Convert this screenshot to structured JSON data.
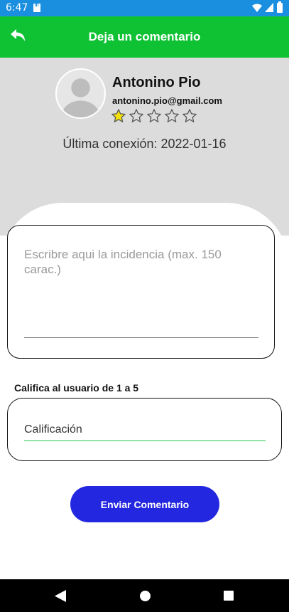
{
  "status_bar": {
    "time": "6:47",
    "background": "#1a8fe0"
  },
  "app_bar": {
    "title": "Deja un comentario",
    "background": "#0fc234",
    "back_icon": "back-arrow-icon"
  },
  "profile": {
    "name": "Antonino Pio",
    "email": "antonino.pio@gmail.com",
    "rating": 1,
    "rating_max": 5,
    "last_seen": "Última conexión: 2022-01-16",
    "avatar_icon": "avatar-placeholder-icon"
  },
  "incident": {
    "placeholder": "Escribre aqui la incidencia (max. 150 carac.)",
    "value": ""
  },
  "rate": {
    "label": "Califica al usuario de 1 a 5",
    "placeholder": "Calificación",
    "value": "",
    "accent": "#22c84a"
  },
  "send_button": {
    "label": "Enviar Comentario",
    "color": "#2427e0"
  },
  "nav_bar": {
    "icons": [
      "nav-back-icon",
      "nav-home-icon",
      "nav-recents-icon"
    ]
  }
}
